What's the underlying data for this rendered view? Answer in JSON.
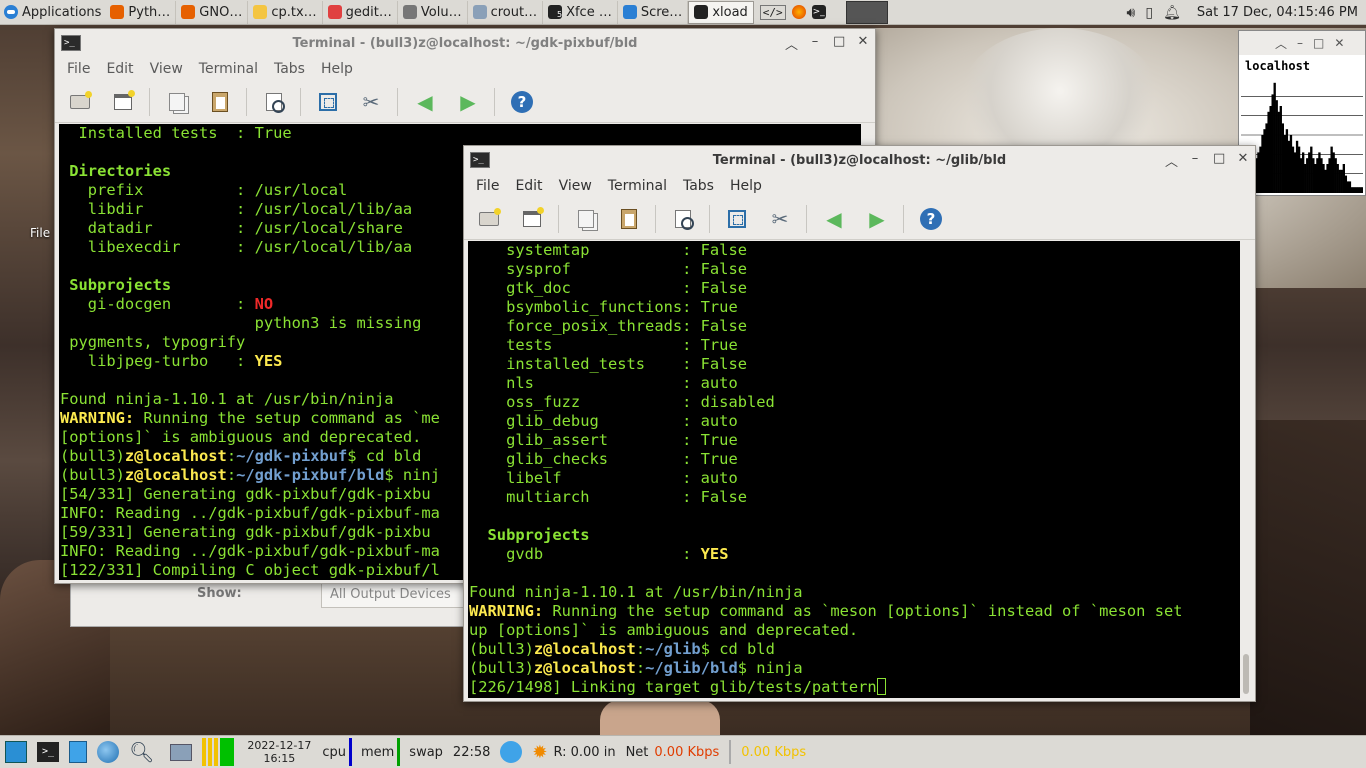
{
  "top_panel": {
    "applications_label": "Applications",
    "tasks": [
      {
        "label": "Pyth…",
        "icon": "firefox-icon",
        "color": "#e66000"
      },
      {
        "label": "GNO…",
        "icon": "firefox-icon",
        "color": "#e66000"
      },
      {
        "label": "cp.tx…",
        "icon": "text-editor-icon",
        "color": "#f4c542"
      },
      {
        "label": "gedit…",
        "icon": "gedit-icon",
        "color": "#e04040"
      },
      {
        "label": "Volu…",
        "icon": "volume-icon",
        "color": "#777"
      },
      {
        "label": "crout…",
        "icon": "folder-icon",
        "color": "#8aa0b8"
      },
      {
        "label": "Xfce …",
        "icon": "terminal-icon",
        "color": "#222"
      },
      {
        "label": "Scre…",
        "icon": "screenshot-icon",
        "color": "#2a7fd4"
      },
      {
        "label": "xload",
        "icon": "xload-icon",
        "color": "#222"
      }
    ],
    "badge_count": "5",
    "clock": "Sat 17 Dec, 04:15:46 PM"
  },
  "desktop": {
    "icon_label": "File"
  },
  "window_back": {
    "title": "Terminal - (bull3)z@localhost: ~/gdk-pixbuf/bld",
    "menu": [
      "File",
      "Edit",
      "View",
      "Terminal",
      "Tabs",
      "Help"
    ],
    "lines": [
      {
        "segs": [
          {
            "t": "  Installed tests  : True",
            "c": "g"
          }
        ]
      },
      {
        "segs": [
          {
            "t": "",
            "c": "g"
          }
        ]
      },
      {
        "segs": [
          {
            "t": " Directories",
            "c": "hdr"
          }
        ]
      },
      {
        "segs": [
          {
            "t": "   prefix          : /usr/local",
            "c": "g"
          }
        ]
      },
      {
        "segs": [
          {
            "t": "   libdir          : /usr/local/lib/aa",
            "c": "g"
          }
        ]
      },
      {
        "segs": [
          {
            "t": "   datadir         : /usr/local/share",
            "c": "g"
          }
        ]
      },
      {
        "segs": [
          {
            "t": "   libexecdir      : /usr/local/lib/aa",
            "c": "g"
          }
        ]
      },
      {
        "segs": [
          {
            "t": "",
            "c": "g"
          }
        ]
      },
      {
        "segs": [
          {
            "t": " Subprojects",
            "c": "hdr"
          }
        ]
      },
      {
        "segs": [
          {
            "t": "   gi-docgen       : ",
            "c": "g"
          },
          {
            "t": "NO",
            "c": "red"
          }
        ]
      },
      {
        "segs": [
          {
            "t": "                     python3 is missing",
            "c": "g"
          }
        ]
      },
      {
        "segs": [
          {
            "t": " pygments, typogrify",
            "c": "g"
          }
        ]
      },
      {
        "segs": [
          {
            "t": "   libjpeg-turbo   : ",
            "c": "g"
          },
          {
            "t": "YES",
            "c": "wy"
          }
        ]
      },
      {
        "segs": [
          {
            "t": "",
            "c": "g"
          }
        ]
      },
      {
        "segs": [
          {
            "t": "Found ninja-1.10.1 at /usr/bin/ninja",
            "c": "g"
          }
        ]
      },
      {
        "segs": [
          {
            "t": "WARNING:",
            "c": "wy"
          },
          {
            "t": " Running the setup command as `me",
            "c": "g"
          }
        ]
      },
      {
        "segs": [
          {
            "t": "[options]` is ambiguous and deprecated.",
            "c": "g"
          }
        ]
      },
      {
        "segs": [
          {
            "t": "(bull3)",
            "c": "g"
          },
          {
            "t": "z@localhost",
            "c": "host"
          },
          {
            "t": ":",
            "c": "g"
          },
          {
            "t": "~/gdk-pixbuf",
            "c": "path"
          },
          {
            "t": "$ cd bld",
            "c": "g"
          }
        ]
      },
      {
        "segs": [
          {
            "t": "(bull3)",
            "c": "g"
          },
          {
            "t": "z@localhost",
            "c": "host"
          },
          {
            "t": ":",
            "c": "g"
          },
          {
            "t": "~/gdk-pixbuf/bld",
            "c": "path"
          },
          {
            "t": "$ ninj",
            "c": "g"
          }
        ]
      },
      {
        "segs": [
          {
            "t": "[54/331] Generating gdk-pixbuf/gdk-pixbu",
            "c": "g"
          }
        ]
      },
      {
        "segs": [
          {
            "t": "INFO: Reading ../gdk-pixbuf/gdk-pixbuf-ma",
            "c": "g"
          }
        ]
      },
      {
        "segs": [
          {
            "t": "[59/331] Generating gdk-pixbuf/gdk-pixbu",
            "c": "g"
          }
        ]
      },
      {
        "segs": [
          {
            "t": "INFO: Reading ../gdk-pixbuf/gdk-pixbuf-ma",
            "c": "g"
          }
        ]
      },
      {
        "segs": [
          {
            "t": "[122/331] Compiling C object gdk-pixbuf/l",
            "c": "g"
          }
        ]
      }
    ]
  },
  "pavucontrol": {
    "show_label": "Show:",
    "show_value": "All Output Devices"
  },
  "window_front": {
    "title": "Terminal - (bull3)z@localhost: ~/glib/bld",
    "menu": [
      "File",
      "Edit",
      "View",
      "Terminal",
      "Tabs",
      "Help"
    ],
    "lines": [
      {
        "segs": [
          {
            "t": "    systemtap          : False",
            "c": "g"
          }
        ]
      },
      {
        "segs": [
          {
            "t": "    sysprof            : False",
            "c": "g"
          }
        ]
      },
      {
        "segs": [
          {
            "t": "    gtk_doc            : False",
            "c": "g"
          }
        ]
      },
      {
        "segs": [
          {
            "t": "    bsymbolic_functions: True",
            "c": "g"
          }
        ]
      },
      {
        "segs": [
          {
            "t": "    force_posix_threads: False",
            "c": "g"
          }
        ]
      },
      {
        "segs": [
          {
            "t": "    tests              : True",
            "c": "g"
          }
        ]
      },
      {
        "segs": [
          {
            "t": "    installed_tests    : False",
            "c": "g"
          }
        ]
      },
      {
        "segs": [
          {
            "t": "    nls                : auto",
            "c": "g"
          }
        ]
      },
      {
        "segs": [
          {
            "t": "    oss_fuzz           : disabled",
            "c": "g"
          }
        ]
      },
      {
        "segs": [
          {
            "t": "    glib_debug         : auto",
            "c": "g"
          }
        ]
      },
      {
        "segs": [
          {
            "t": "    glib_assert        : True",
            "c": "g"
          }
        ]
      },
      {
        "segs": [
          {
            "t": "    glib_checks        : True",
            "c": "g"
          }
        ]
      },
      {
        "segs": [
          {
            "t": "    libelf             : auto",
            "c": "g"
          }
        ]
      },
      {
        "segs": [
          {
            "t": "    multiarch          : False",
            "c": "g"
          }
        ]
      },
      {
        "segs": [
          {
            "t": "",
            "c": "g"
          }
        ]
      },
      {
        "segs": [
          {
            "t": "  Subprojects",
            "c": "hdr"
          }
        ]
      },
      {
        "segs": [
          {
            "t": "    gvdb               : ",
            "c": "g"
          },
          {
            "t": "YES",
            "c": "wy"
          }
        ]
      },
      {
        "segs": [
          {
            "t": "",
            "c": "g"
          }
        ]
      },
      {
        "segs": [
          {
            "t": "Found ninja-1.10.1 at /usr/bin/ninja",
            "c": "g"
          }
        ]
      },
      {
        "segs": [
          {
            "t": "WARNING:",
            "c": "wy"
          },
          {
            "t": " Running the setup command as `meson [options]` instead of `meson set",
            "c": "g"
          }
        ]
      },
      {
        "segs": [
          {
            "t": "up [options]` is ambiguous and deprecated.",
            "c": "g"
          }
        ]
      },
      {
        "segs": [
          {
            "t": "(bull3)",
            "c": "g"
          },
          {
            "t": "z@localhost",
            "c": "host"
          },
          {
            "t": ":",
            "c": "g"
          },
          {
            "t": "~/glib",
            "c": "path"
          },
          {
            "t": "$ cd bld",
            "c": "g"
          }
        ]
      },
      {
        "segs": [
          {
            "t": "(bull3)",
            "c": "g"
          },
          {
            "t": "z@localhost",
            "c": "host"
          },
          {
            "t": ":",
            "c": "g"
          },
          {
            "t": "~/glib/bld",
            "c": "path"
          },
          {
            "t": "$ ninja",
            "c": "g"
          }
        ]
      },
      {
        "segs": [
          {
            "t": "[226/1498] Linking target glib/tests/pattern",
            "c": "g"
          }
        ],
        "cursor": true
      }
    ]
  },
  "xload": {
    "hostname": "localhost",
    "load_samples": [
      0.05,
      0.05,
      0.1,
      0.1,
      0.15,
      0.2,
      0.2,
      0.3,
      0.35,
      0.4,
      0.5,
      0.55,
      0.6,
      0.7,
      0.75,
      0.85,
      0.95,
      0.8,
      0.7,
      0.75,
      0.6,
      0.5,
      0.55,
      0.45,
      0.5,
      0.4,
      0.35,
      0.45,
      0.4,
      0.3,
      0.35,
      0.25,
      0.3,
      0.35,
      0.4,
      0.3,
      0.25,
      0.3,
      0.35,
      0.3,
      0.25,
      0.2,
      0.25,
      0.3,
      0.4,
      0.35,
      0.3,
      0.25,
      0.2,
      0.2,
      0.25,
      0.15,
      0.1,
      0.1,
      0.05,
      0.05,
      0.05,
      0.05,
      0.05,
      0.05
    ]
  },
  "bottom_panel": {
    "date": "2022-12-17",
    "time": "16:15",
    "cpu_label": "cpu",
    "mem_label": "mem",
    "swap_label": "swap",
    "clock2": "22:58",
    "rain": "R: 0.00 in",
    "net_label": "Net",
    "net_down": "0.00 Kbps",
    "net_up": "0.00 Kbps"
  }
}
